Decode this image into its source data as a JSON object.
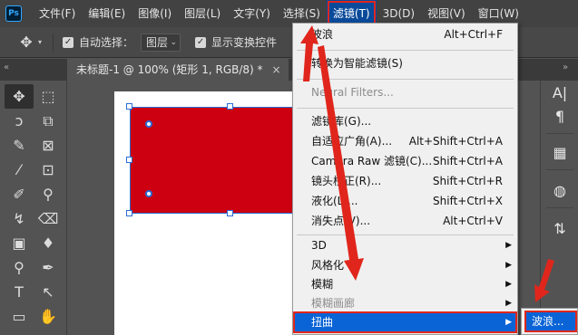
{
  "app": {
    "logo": "Ps"
  },
  "menubar": {
    "items": [
      {
        "label": "文件(F)"
      },
      {
        "label": "编辑(E)"
      },
      {
        "label": "图像(I)"
      },
      {
        "label": "图层(L)"
      },
      {
        "label": "文字(Y)"
      },
      {
        "label": "选择(S)"
      },
      {
        "label": "滤镜(T)"
      },
      {
        "label": "3D(D)"
      },
      {
        "label": "视图(V)"
      },
      {
        "label": "窗口(W)"
      }
    ]
  },
  "options_bar": {
    "auto_select_label": "自动选择：",
    "auto_select_checked": "✓",
    "layer_select_value": "图层",
    "show_transform_checked": "✓",
    "show_transform_label": "显示变换控件"
  },
  "document_tab": {
    "title": "未标题-1 @ 100% (矩形 1, RGB/8) *",
    "close": "×"
  },
  "filter_menu": {
    "items": [
      {
        "label": "波浪",
        "shortcut": "Alt+Ctrl+F"
      },
      {
        "label": "转换为智能滤镜(S)",
        "shortcut": ""
      },
      {
        "label": "Neural Filters...",
        "shortcut": "",
        "disabled": true
      },
      {
        "label": "滤镜库(G)...",
        "shortcut": ""
      },
      {
        "label": "自适应广角(A)...",
        "shortcut": "Alt+Shift+Ctrl+A"
      },
      {
        "label": "Camera Raw 滤镜(C)...",
        "shortcut": "Shift+Ctrl+A"
      },
      {
        "label": "镜头校正(R)...",
        "shortcut": "Shift+Ctrl+R"
      },
      {
        "label": "液化(L)...",
        "shortcut": "Shift+Ctrl+X"
      },
      {
        "label": "消失点(V)...",
        "shortcut": "Alt+Ctrl+V"
      },
      {
        "label": "3D",
        "submenu": true
      },
      {
        "label": "风格化",
        "submenu": true
      },
      {
        "label": "模糊",
        "submenu": true
      },
      {
        "label": "模糊画廊",
        "submenu": true,
        "disabled": true
      },
      {
        "label": "扭曲",
        "submenu": true,
        "highlighted": true
      }
    ]
  },
  "distort_submenu": {
    "items": [
      {
        "label": "波浪...",
        "highlighted": true
      }
    ]
  },
  "colors": {
    "accent_highlight": "#0a64d6",
    "callout_red": "#e0261c",
    "shape_fill": "#cc0011"
  }
}
